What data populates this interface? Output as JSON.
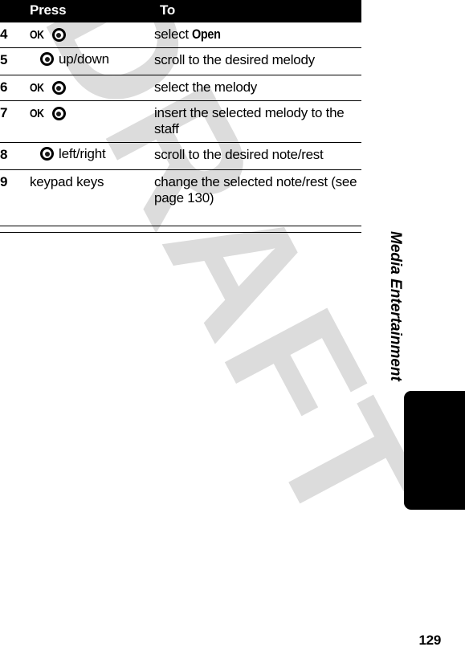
{
  "document": {
    "watermark_text": "DRAFT",
    "watermark_color": "#dcdcdc",
    "running_head": "Media Entertainment",
    "page_number": "129",
    "thumb_tab_color": "#000000"
  },
  "table": {
    "header": {
      "number_label": "",
      "press_label": "Press",
      "to_label": "To"
    },
    "rows": [
      {
        "number": "4",
        "press": {
          "type": "ok-plus-navkey",
          "ok_label": "OK",
          "icon": "navigation-key-icon",
          "text": ""
        },
        "to_prefix": "select ",
        "to_keyword": "Open",
        "to_suffix": ""
      },
      {
        "number": "5",
        "press": {
          "type": "navkey-plus-text",
          "ok_label": "",
          "icon": "navigation-key-icon",
          "text": "up/down"
        },
        "to_prefix": "scroll to the desired melody",
        "to_keyword": "",
        "to_suffix": ""
      },
      {
        "number": "6",
        "press": {
          "type": "ok-plus-navkey",
          "ok_label": "OK",
          "icon": "navigation-key-icon",
          "text": ""
        },
        "to_prefix": "select the melody",
        "to_keyword": "",
        "to_suffix": ""
      },
      {
        "number": "7",
        "press": {
          "type": "ok-plus-navkey",
          "ok_label": "OK",
          "icon": "navigation-key-icon",
          "text": ""
        },
        "to_prefix": "insert the selected melody to the staff",
        "to_keyword": "",
        "to_suffix": ""
      },
      {
        "number": "8",
        "press": {
          "type": "navkey-plus-text",
          "ok_label": "",
          "icon": "navigation-key-icon",
          "text": "left/right"
        },
        "to_prefix": "scroll to the desired note/rest",
        "to_keyword": "",
        "to_suffix": ""
      },
      {
        "number": "9",
        "press": {
          "type": "text-only",
          "ok_label": "",
          "icon": "",
          "text": "keypad keys"
        },
        "to_prefix": "change the selected note/rest (see page 130)",
        "to_keyword": "",
        "to_suffix": ""
      }
    ]
  }
}
